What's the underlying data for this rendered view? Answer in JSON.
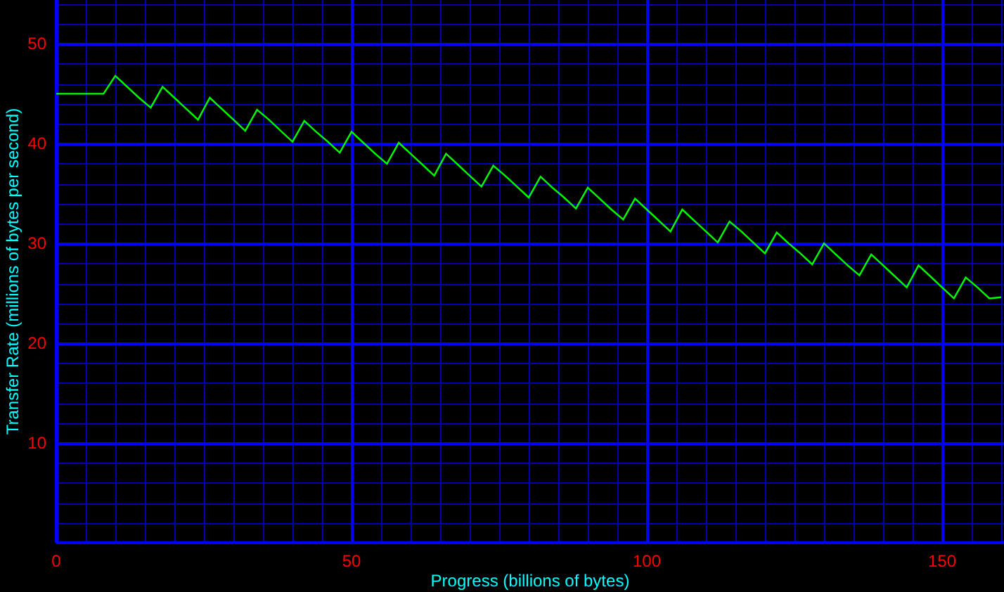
{
  "chart_data": {
    "type": "line",
    "xlabel": "Progress (billions of bytes)",
    "ylabel": "Transfer Rate (millions of bytes per second)",
    "x": [
      0,
      2,
      4,
      6,
      8,
      10,
      12,
      14,
      16,
      18,
      20,
      22,
      24,
      26,
      28,
      30,
      32,
      34,
      36,
      38,
      40,
      42,
      44,
      46,
      48,
      50,
      52,
      54,
      56,
      58,
      60,
      62,
      64,
      66,
      68,
      70,
      72,
      74,
      76,
      78,
      80,
      82,
      84,
      86,
      88,
      90,
      92,
      94,
      96,
      98,
      100,
      102,
      104,
      106,
      108,
      110,
      112,
      114,
      116,
      118,
      120,
      122,
      124,
      126,
      128,
      130,
      132,
      134,
      136,
      138,
      140,
      142,
      144,
      146,
      148,
      150,
      152,
      154,
      156,
      158,
      160
    ],
    "series": [
      {
        "color": "#00ff00",
        "values": [
          45,
          45,
          45,
          45,
          45,
          46.8,
          45.7,
          44.6,
          43.6,
          45.7,
          44.6,
          43.5,
          42.4,
          44.6,
          43.5,
          42.4,
          41.3,
          43.4,
          42.4,
          41.3,
          40.2,
          42.3,
          41.2,
          40.2,
          39.1,
          41.2,
          40.1,
          39.0,
          38.0,
          40.1,
          39.0,
          37.9,
          36.8,
          39.0,
          37.9,
          36.8,
          35.7,
          37.8,
          36.8,
          35.7,
          34.6,
          36.7,
          35.6,
          34.6,
          33.5,
          35.6,
          34.5,
          33.4,
          32.4,
          34.5,
          33.4,
          32.3,
          31.2,
          33.4,
          32.3,
          31.2,
          30.1,
          32.2,
          31.2,
          30.1,
          29.0,
          31.1,
          30.0,
          29.0,
          27.9,
          30.0,
          28.9,
          27.8,
          26.8,
          28.9,
          27.8,
          26.7,
          25.6,
          27.8,
          26.7,
          25.6,
          24.5,
          26.6,
          25.6,
          24.5,
          24.6
        ]
      }
    ],
    "xlim": [
      0,
      160
    ],
    "ylim": [
      0,
      54.4
    ],
    "xticks": [
      0,
      50,
      100,
      150
    ],
    "yticks": [
      10,
      20,
      30,
      40,
      50
    ],
    "grid": true
  }
}
